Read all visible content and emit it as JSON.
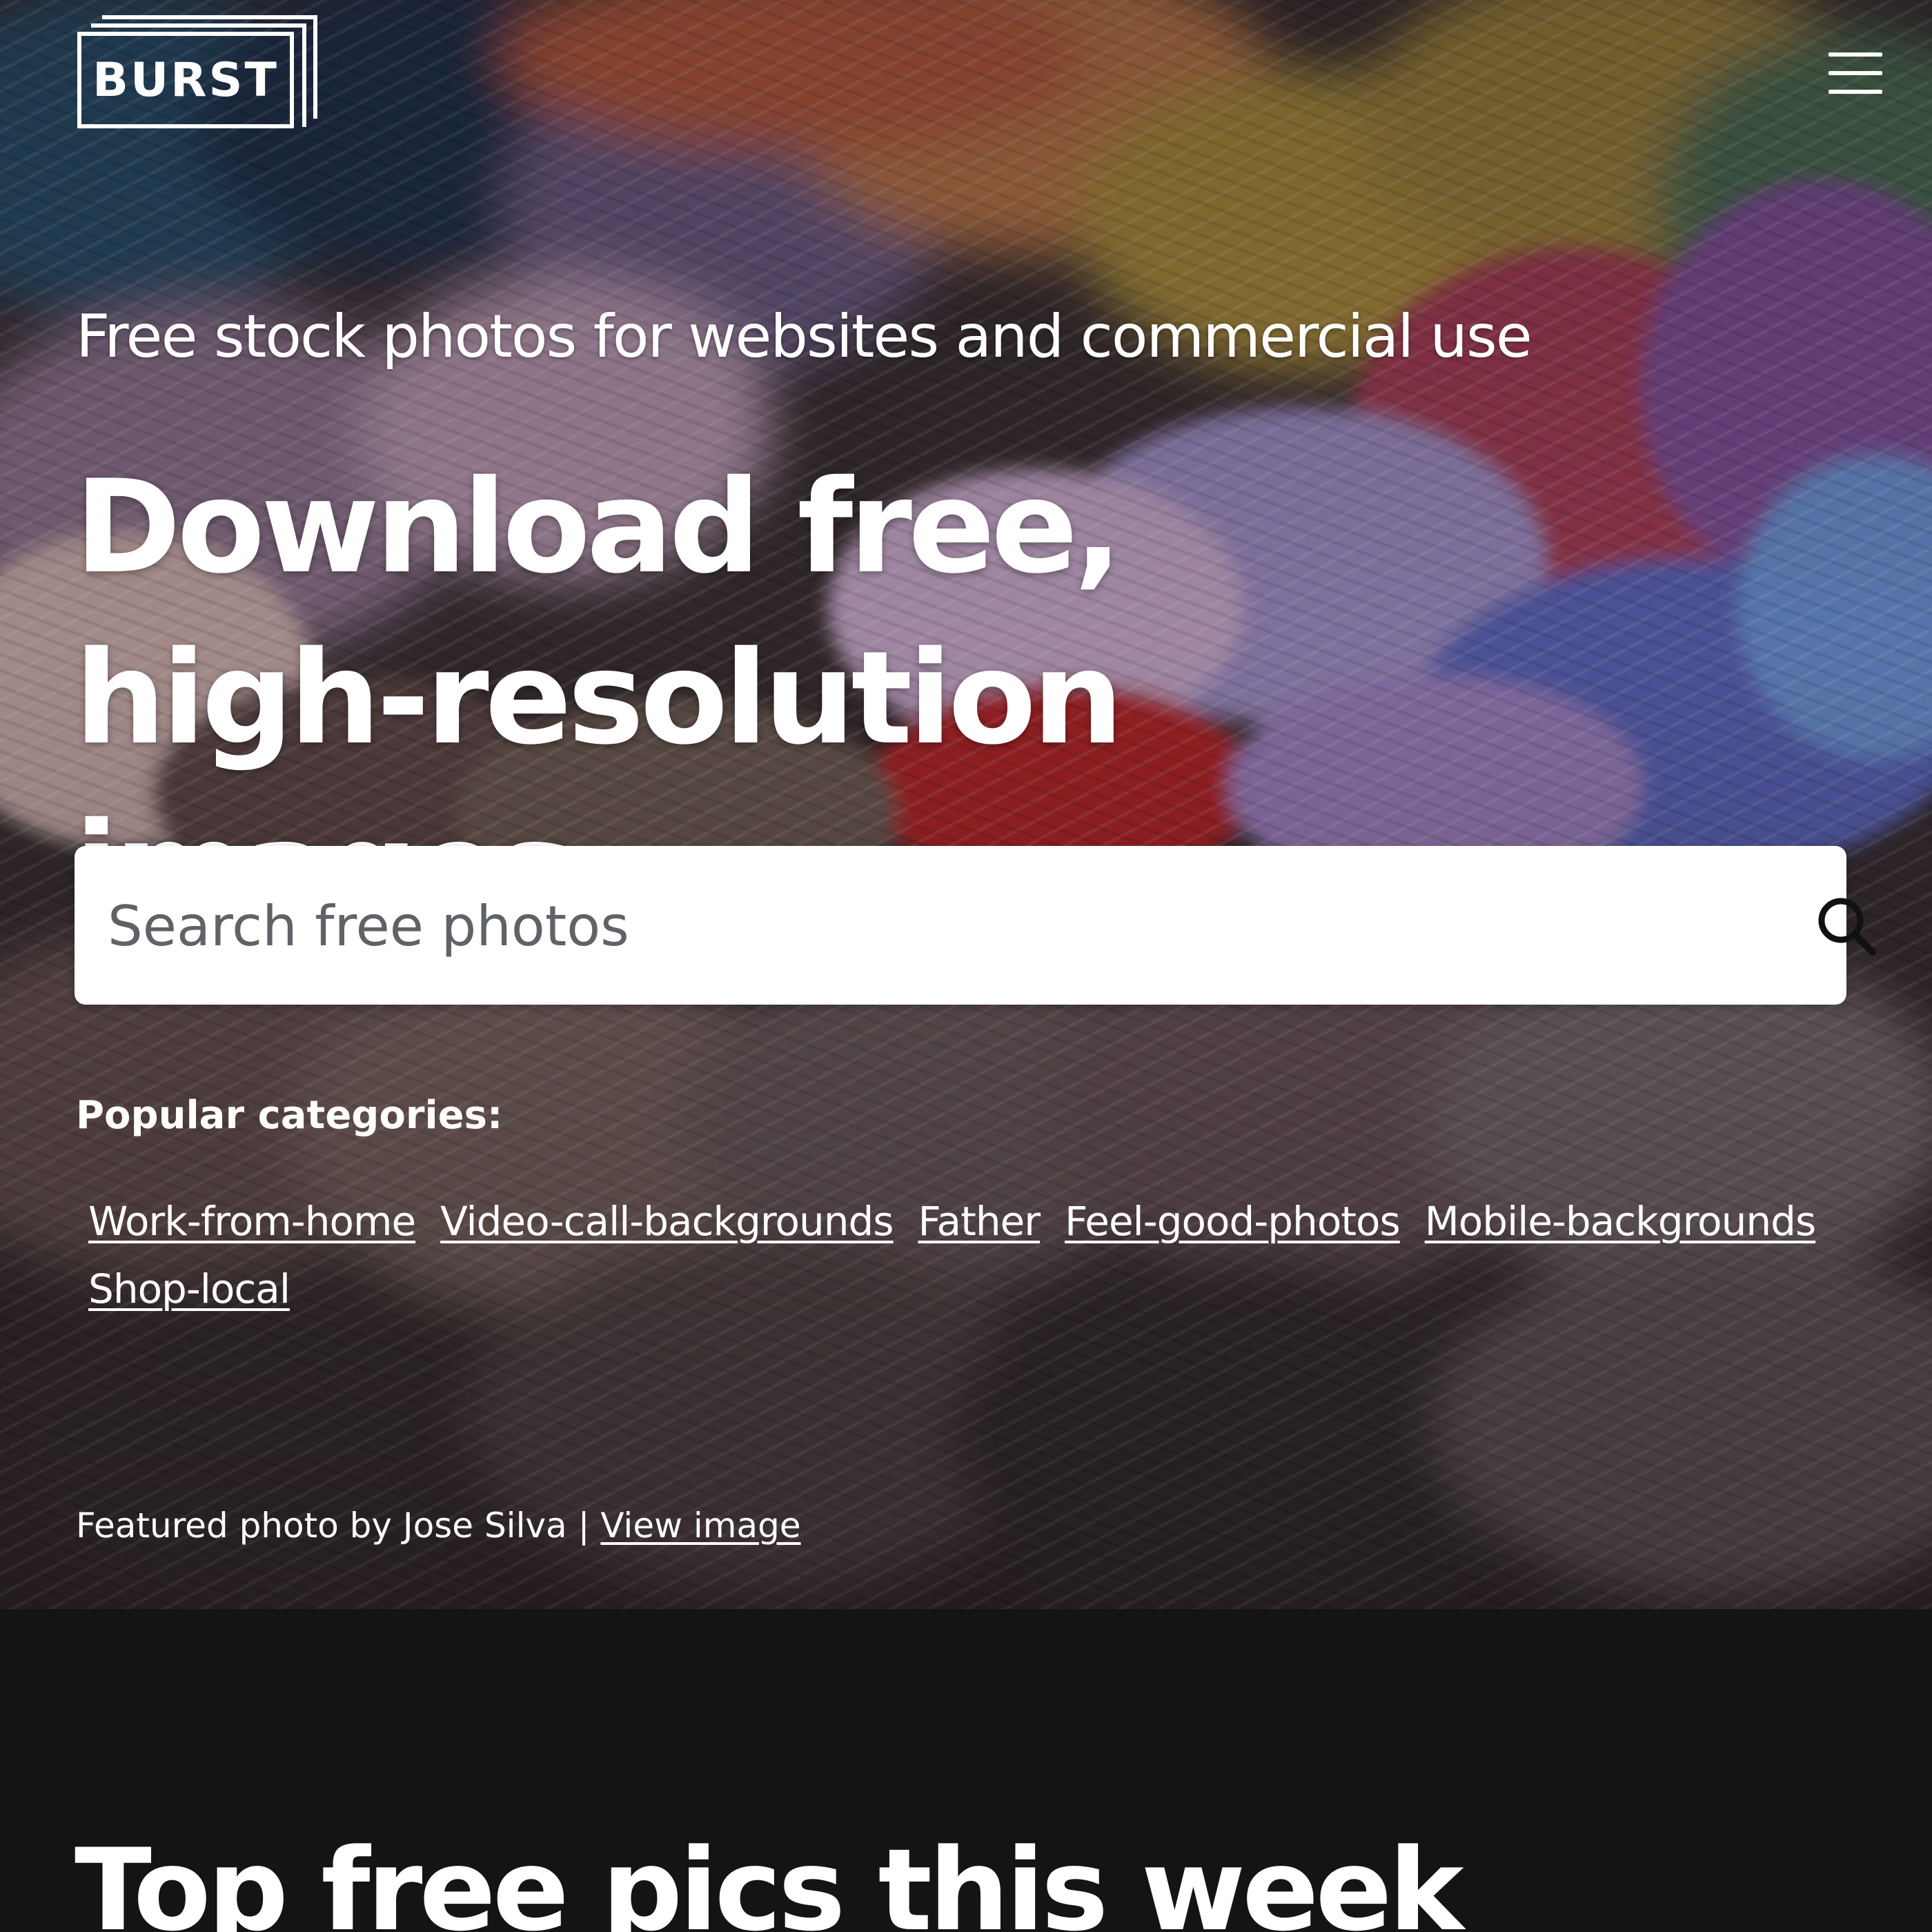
{
  "header": {
    "logo_text": "BURST",
    "menu_icon": "hamburger-menu-icon"
  },
  "hero": {
    "tagline": "Free stock photos for websites and commercial use",
    "headline": "Download free, high-resolution images",
    "search": {
      "placeholder": "Search free photos",
      "value": "",
      "icon": "search-icon"
    },
    "popular_label": "Popular categories:",
    "categories": [
      "Work-from-home",
      "Video-call-backgrounds",
      "Father",
      "Feel-good-photos",
      "Mobile-backgrounds",
      "Shop-local"
    ],
    "credit_prefix": "Featured photo by Jose Silva | ",
    "credit_link": "View image"
  },
  "main": {
    "section_title": "Top free pics this week"
  },
  "colors": {
    "page_background": "#141414",
    "text": "#ffffff",
    "search_background": "#ffffff",
    "search_placeholder": "#5f6368"
  }
}
